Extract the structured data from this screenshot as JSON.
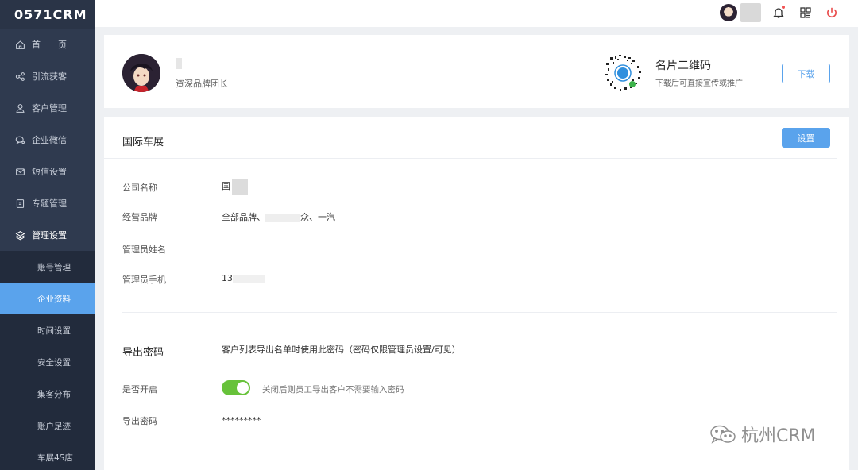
{
  "app": {
    "logo": "0571CRM"
  },
  "sidebar": {
    "items": [
      {
        "label": "首　　页",
        "icon": "home-icon"
      },
      {
        "label": "引流获客",
        "icon": "share-icon"
      },
      {
        "label": "客户管理",
        "icon": "user-icon"
      },
      {
        "label": "企业微信",
        "icon": "chat-icon"
      },
      {
        "label": "短信设置",
        "icon": "mail-icon"
      },
      {
        "label": "专题管理",
        "icon": "document-icon"
      },
      {
        "label": "管理设置",
        "icon": "layers-icon"
      }
    ],
    "sub_items": [
      {
        "label": "账号管理"
      },
      {
        "label": "企业资料",
        "active": true
      },
      {
        "label": "时间设置"
      },
      {
        "label": "安全设置"
      },
      {
        "label": "集客分布"
      },
      {
        "label": "账户足迹"
      },
      {
        "label": "车展4S店"
      }
    ]
  },
  "topbar": {
    "icons": [
      "bell-icon",
      "grid-icon",
      "power-icon"
    ]
  },
  "profile": {
    "role": "资深品牌团长",
    "qr_title": "名片二维码",
    "qr_subtitle": "下载后可直接宣传或推广",
    "download_label": "下载"
  },
  "company": {
    "title": "国际车展",
    "settings_label": "设置",
    "fields": [
      {
        "label": "公司名称",
        "value": "国"
      },
      {
        "label": "经营品牌",
        "value": "全部品牌、",
        "value_tail": "众、一汽"
      },
      {
        "label": "管理员姓名",
        "value": ""
      },
      {
        "label": "管理员手机",
        "value": "13"
      }
    ]
  },
  "export": {
    "title": "导出密码",
    "description": "客户列表导出名单时使用此密码（密码仅限管理员设置/可见）",
    "enable_label": "是否开启",
    "enabled": true,
    "toggle_hint": "关闭后则员工导出客户不需要输入密码",
    "password_label": "导出密码",
    "password_value": "*********"
  },
  "watermark": {
    "text": "杭州CRM"
  },
  "colors": {
    "sidebar": "#2f3a4f",
    "accent": "#5aa3ec",
    "toggle_on": "#67c23a"
  }
}
